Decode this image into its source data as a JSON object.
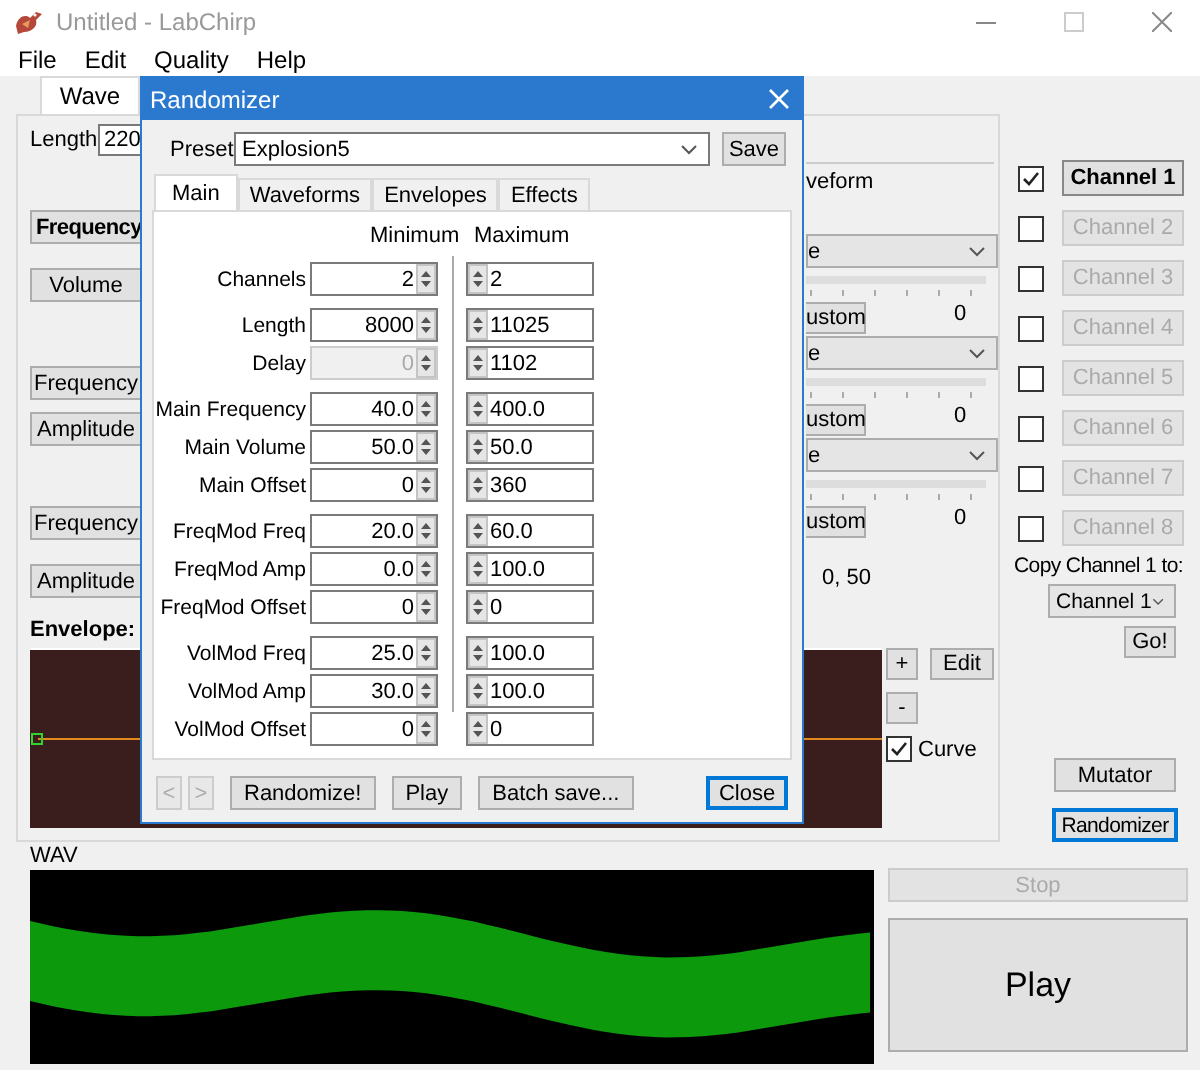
{
  "window": {
    "title": "Untitled - LabChirp"
  },
  "menu": [
    "File",
    "Edit",
    "Quality",
    "Help"
  ],
  "tabs": [
    {
      "label": "Wave",
      "selected": true
    }
  ],
  "wave_panel": {
    "length_label": "Length",
    "length_value": "220",
    "left_buttons": [
      {
        "label": "Frequency",
        "kind": "header"
      },
      {
        "label": "Volume",
        "kind": "button"
      },
      {
        "label": "Frequency",
        "kind": "button"
      },
      {
        "label": "Amplitude",
        "kind": "button"
      },
      {
        "label": "Frequency",
        "kind": "button"
      },
      {
        "label": "Amplitude",
        "kind": "button"
      }
    ],
    "waveform_label": "veform",
    "generators": [
      {
        "dropdown": "e",
        "reading": "0",
        "button": "ustom"
      },
      {
        "dropdown": "e",
        "reading": "0",
        "button": "ustom"
      },
      {
        "dropdown": "e",
        "reading": "0",
        "button": "ustom"
      }
    ],
    "envelope": {
      "title": "Envelope:",
      "point": "0, 50",
      "buttons": [
        "+",
        "Edit",
        "-"
      ],
      "curve": {
        "label": "Curve",
        "checked": true
      }
    }
  },
  "channels": [
    {
      "label": "Channel 1",
      "checked": true,
      "disabled": false
    },
    {
      "label": "Channel 2",
      "checked": false,
      "disabled": true
    },
    {
      "label": "Channel 3",
      "checked": false,
      "disabled": true
    },
    {
      "label": "Channel 4",
      "checked": false,
      "disabled": true
    },
    {
      "label": "Channel 5",
      "checked": false,
      "disabled": true
    },
    {
      "label": "Channel 6",
      "checked": false,
      "disabled": true
    },
    {
      "label": "Channel 7",
      "checked": false,
      "disabled": true
    },
    {
      "label": "Channel 8",
      "checked": false,
      "disabled": true
    }
  ],
  "copy": {
    "label": "Copy Channel 1 to:",
    "target": "Channel 1",
    "go": "Go!"
  },
  "tools": [
    {
      "label": "Mutator",
      "focused": false
    },
    {
      "label": "Randomizer",
      "focused": true
    }
  ],
  "wav": {
    "label": "WAV",
    "stop": {
      "label": "Stop",
      "disabled": true
    },
    "play": "Play"
  },
  "dialog": {
    "title": "Randomizer",
    "preset_label": "Preset",
    "preset": "Explosion5",
    "save": "Save",
    "tabs": [
      {
        "label": "Main",
        "selected": true
      },
      {
        "label": "Waveforms",
        "selected": false
      },
      {
        "label": "Envelopes",
        "selected": false
      },
      {
        "label": "Effects",
        "selected": false
      }
    ],
    "headers": [
      "Minimum",
      "Maximum"
    ],
    "groups": [
      [
        {
          "label": "Channels",
          "min": "2",
          "max": "2",
          "min_disabled": false
        }
      ],
      [
        {
          "label": "Length",
          "min": "8000",
          "max": "11025",
          "min_disabled": false
        },
        {
          "label": "Delay",
          "min": "0",
          "max": "1102",
          "min_disabled": true
        }
      ],
      [
        {
          "label": "Main Frequency",
          "min": "40.0",
          "max": "400.0",
          "min_disabled": false
        },
        {
          "label": "Main Volume",
          "min": "50.0",
          "max": "50.0",
          "min_disabled": false
        },
        {
          "label": "Main Offset",
          "min": "0",
          "max": "360",
          "min_disabled": false
        }
      ],
      [
        {
          "label": "FreqMod Freq",
          "min": "20.0",
          "max": "60.0",
          "min_disabled": false
        },
        {
          "label": "FreqMod Amp",
          "min": "0.0",
          "max": "100.0",
          "min_disabled": false
        },
        {
          "label": "FreqMod Offset",
          "min": "0",
          "max": "0",
          "min_disabled": false
        }
      ],
      [
        {
          "label": "VolMod Freq",
          "min": "25.0",
          "max": "100.0",
          "min_disabled": false
        },
        {
          "label": "VolMod Amp",
          "min": "30.0",
          "max": "100.0",
          "min_disabled": false
        },
        {
          "label": "VolMod Offset",
          "min": "0",
          "max": "0",
          "min_disabled": false
        }
      ]
    ],
    "buttons": [
      {
        "label": "<",
        "kind": "nav",
        "disabled": true
      },
      {
        "label": ">",
        "kind": "nav",
        "disabled": true
      },
      {
        "label": "Randomize!",
        "kind": "normal",
        "disabled": false
      },
      {
        "label": "Play",
        "kind": "normal",
        "disabled": false
      },
      {
        "label": "Batch save...",
        "kind": "normal",
        "disabled": false
      },
      {
        "label": "Close",
        "kind": "default",
        "disabled": false
      }
    ]
  }
}
